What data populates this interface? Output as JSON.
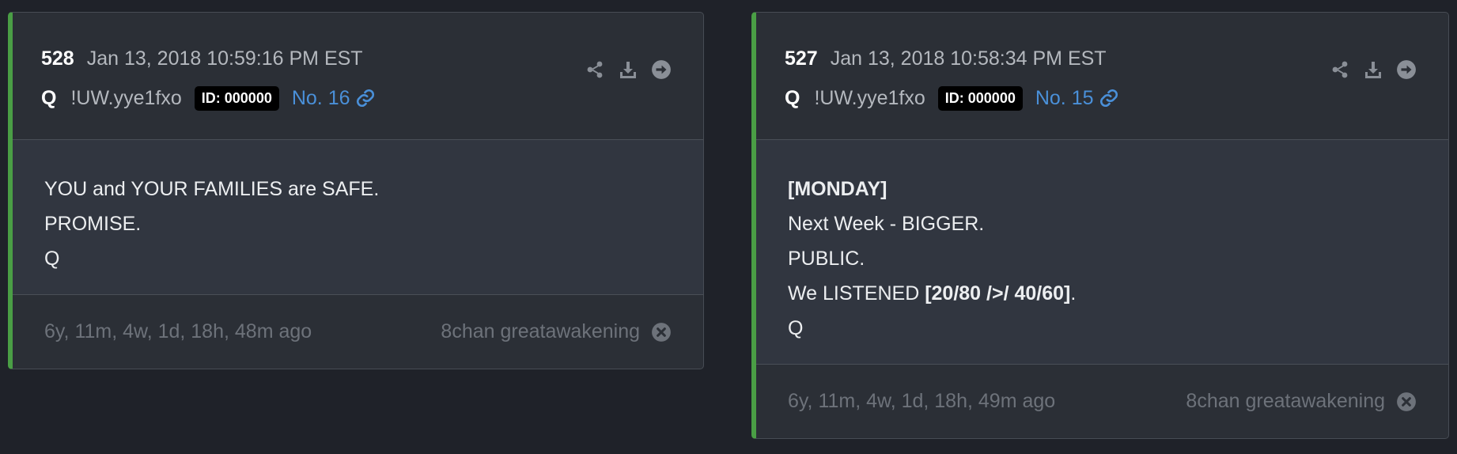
{
  "posts": [
    {
      "number": "528",
      "timestamp": "Jan 13, 2018 10:59:16 PM EST",
      "author": "Q",
      "tripcode": "!UW.yye1fxo",
      "id_badge": "ID: 000000",
      "post_no": "No. 16",
      "body": {
        "line1": "YOU and YOUR FAMILIES are SAFE.",
        "line2": "PROMISE.",
        "line3": "Q"
      },
      "age": "6y, 11m, 4w, 1d, 18h, 48m ago",
      "source": "8chan greatawakening"
    },
    {
      "number": "527",
      "timestamp": "Jan 13, 2018 10:58:34 PM EST",
      "author": "Q",
      "tripcode": "!UW.yye1fxo",
      "id_badge": "ID: 000000",
      "post_no": "No. 15",
      "body": {
        "line1": "[MONDAY]",
        "line2": "Next Week - BIGGER.",
        "line3": "PUBLIC.",
        "line4_a": "We LISTENED ",
        "line4_b": "[20/80 />/ 40/60]",
        "line4_c": ".",
        "line5": "Q"
      },
      "age": "6y, 11m, 4w, 1d, 18h, 49m ago",
      "source": "8chan greatawakening"
    }
  ],
  "icons": {
    "share": "share-icon",
    "download": "download-icon",
    "goto": "arrow-circle-right-icon",
    "link": "link-icon",
    "close": "close-circle-icon"
  },
  "colors": {
    "background": "#1f2229",
    "card": "#2b2f36",
    "accent_border": "#4a9e45",
    "link": "#4a90d9"
  }
}
